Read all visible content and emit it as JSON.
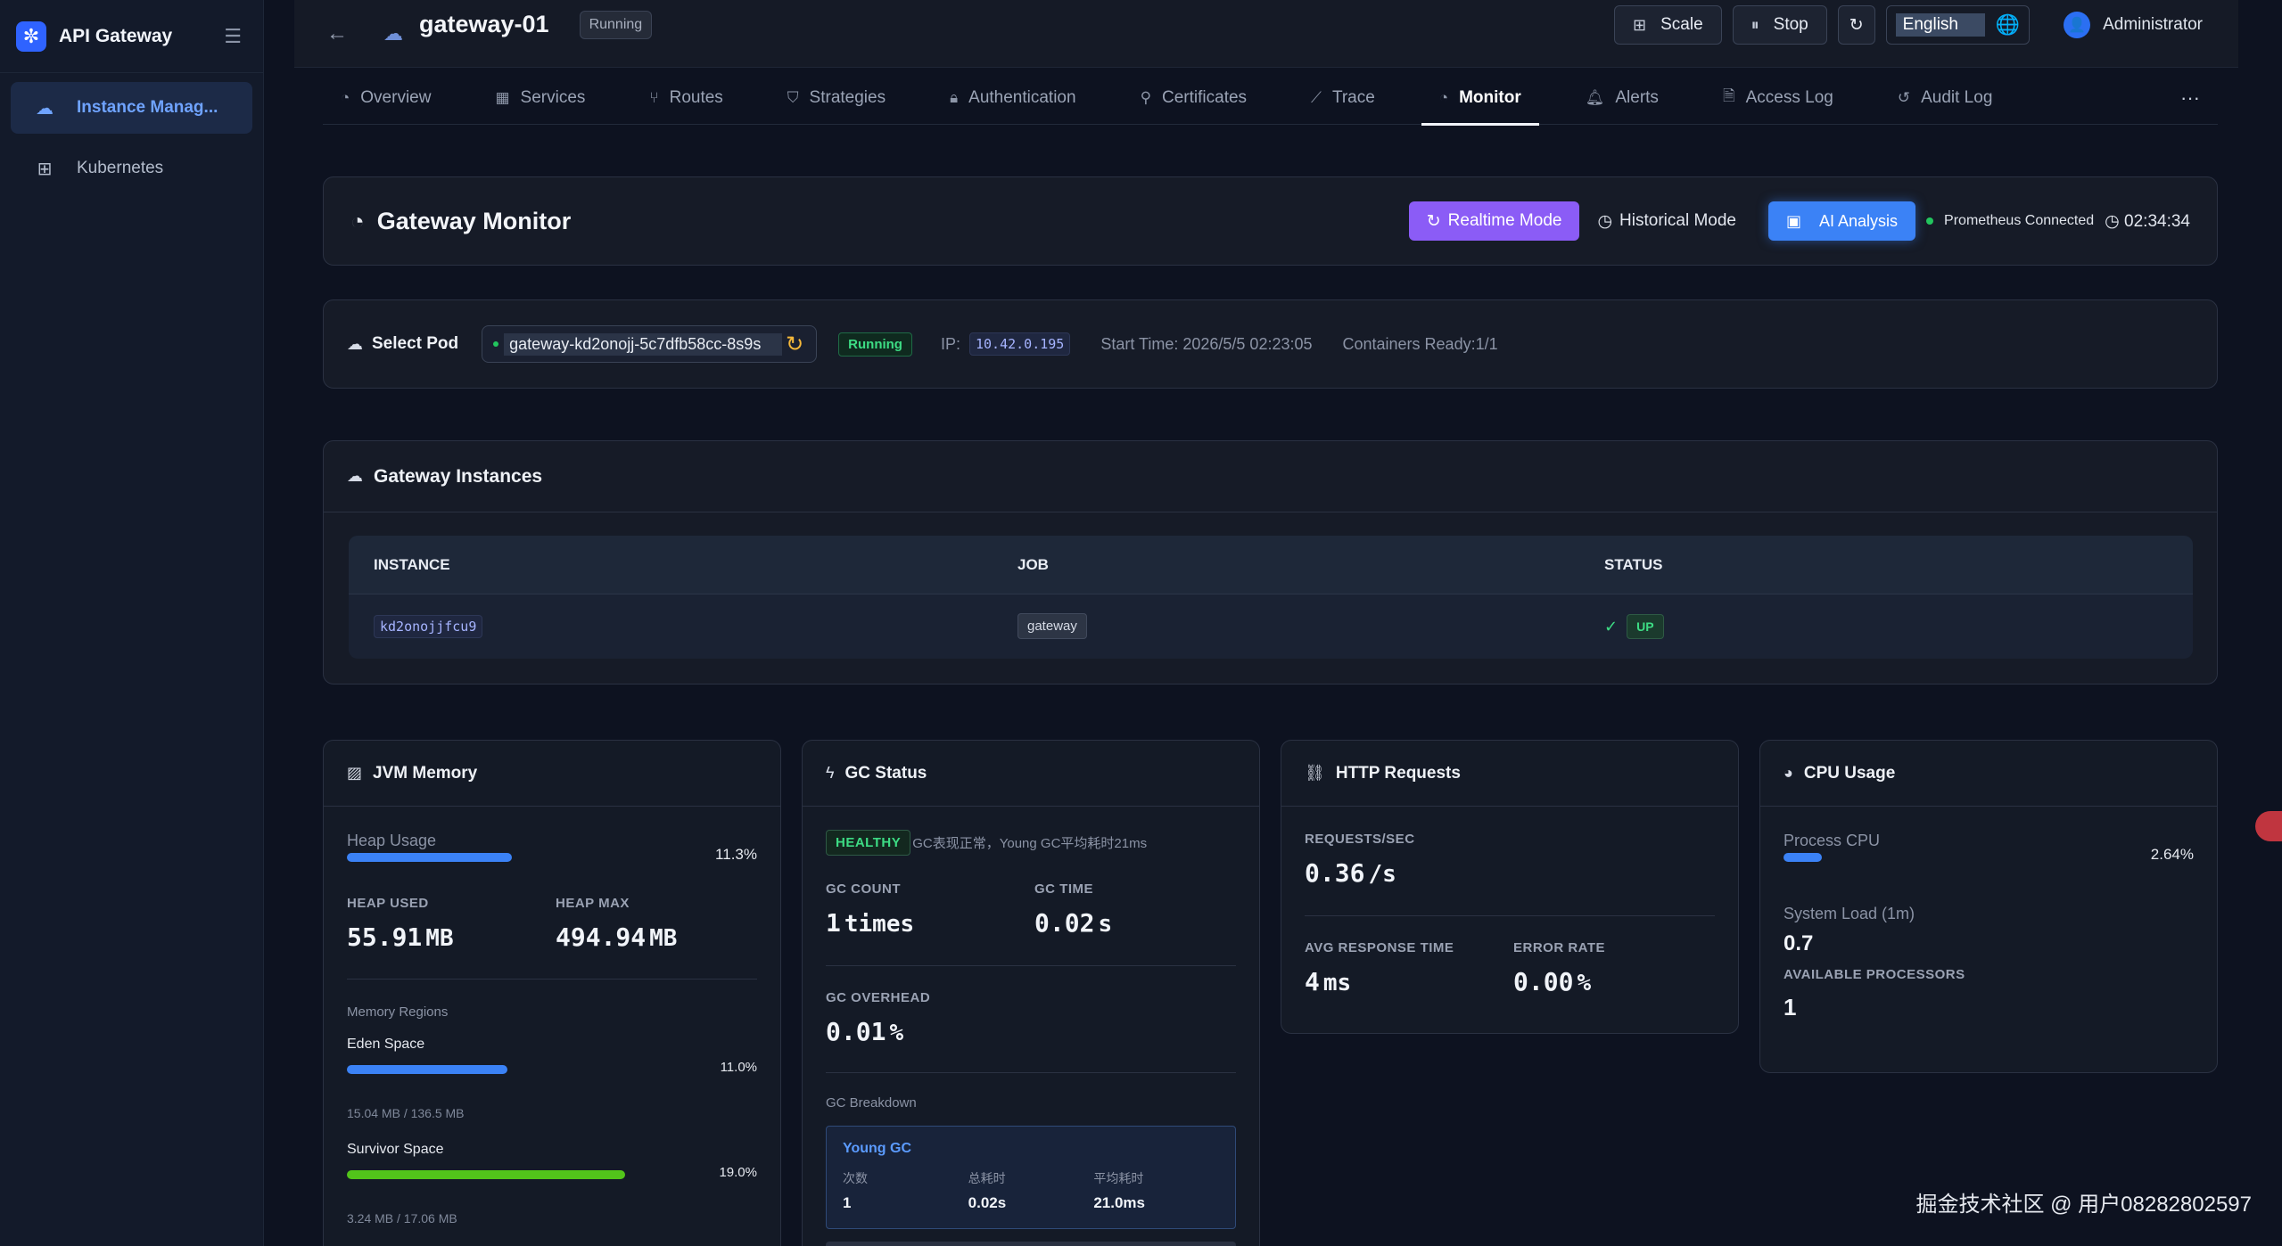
{
  "app": {
    "title": "API Gateway"
  },
  "sidebar": {
    "items": [
      {
        "label": "Instance Manag...",
        "icon": "cloud-icon",
        "active": true
      },
      {
        "label": "Kubernetes",
        "icon": "cluster-icon",
        "active": false
      }
    ]
  },
  "header": {
    "gateway_name": "gateway-01",
    "status": "Running",
    "scale_label": "Scale",
    "stop_label": "Stop",
    "language": "English",
    "user": "Administrator"
  },
  "tabs": [
    {
      "label": "Overview",
      "icon": "gauge-icon"
    },
    {
      "label": "Services",
      "icon": "grid-icon"
    },
    {
      "label": "Routes",
      "icon": "route-icon"
    },
    {
      "label": "Strategies",
      "icon": "shield-icon"
    },
    {
      "label": "Authentication",
      "icon": "lock-icon"
    },
    {
      "label": "Certificates",
      "icon": "key-icon"
    },
    {
      "label": "Trace",
      "icon": "chart-line-icon"
    },
    {
      "label": "Monitor",
      "icon": "gauge-icon",
      "active": true
    },
    {
      "label": "Alerts",
      "icon": "bell-icon"
    },
    {
      "label": "Access Log",
      "icon": "file-icon"
    },
    {
      "label": "Audit Log",
      "icon": "history-icon"
    }
  ],
  "monitor": {
    "title": "Gateway Monitor",
    "realtime_label": "Realtime Mode",
    "historical_label": "Historical Mode",
    "ai_label": "AI Analysis",
    "prometheus": "Prometheus Connected",
    "time": "02:34:34"
  },
  "pod": {
    "label": "Select Pod",
    "selected": "gateway-kd2onojj-5c7dfb58cc-8s9s",
    "status": "Running",
    "ip_label": "IP:",
    "ip": "10.42.0.195",
    "start_time": "Start Time: 2026/5/5 02:23:05",
    "containers": "Containers Ready:1/1"
  },
  "instances": {
    "title": "Gateway Instances",
    "columns": [
      "INSTANCE",
      "JOB",
      "STATUS"
    ],
    "rows": [
      {
        "instance": "kd2onojjfcu9",
        "job": "gateway",
        "status": "UP"
      }
    ]
  },
  "jvm": {
    "title": "JVM Memory",
    "heap_usage_label": "Heap Usage",
    "heap_usage_pct": "11.3%",
    "heap_usage_value": 0.113,
    "heap_used_label": "HEAP USED",
    "heap_used": "55.91",
    "heap_max_label": "HEAP MAX",
    "heap_max": "494.94",
    "unit": "MB",
    "regions_label": "Memory Regions",
    "regions": [
      {
        "name": "Eden Space",
        "pct": "11.0%",
        "value": 0.11,
        "detail": "15.04 MB / 136.5 MB",
        "color": "#3b82f6"
      },
      {
        "name": "Survivor Space",
        "pct": "19.0%",
        "value": 0.19,
        "detail": "3.24 MB / 17.06 MB",
        "color": "#52c41a"
      }
    ]
  },
  "gc": {
    "title": "GC Status",
    "health": "HEALTHY",
    "message": "GC表现正常，Young GC平均耗时21ms",
    "count_label": "GC COUNT",
    "count": "1",
    "count_unit": "times",
    "time_label": "GC TIME",
    "time": "0.02",
    "time_unit": "s",
    "overhead_label": "GC OVERHEAD",
    "overhead": "0.01",
    "overhead_unit": "%",
    "breakdown_label": "GC Breakdown",
    "young": {
      "title": "Young GC",
      "count_label": "次数",
      "count": "1",
      "total_label": "总耗时",
      "total": "0.02s",
      "avg_label": "平均耗时",
      "avg": "21.0ms"
    }
  },
  "http": {
    "title": "HTTP Requests",
    "rps_label": "REQUESTS/SEC",
    "rps": "0.36",
    "rps_unit": "/s",
    "avg_label": "AVG RESPONSE TIME",
    "avg": "4",
    "avg_unit": "ms",
    "err_label": "ERROR RATE",
    "err": "0.00",
    "err_unit": "%"
  },
  "cpu": {
    "title": "CPU Usage",
    "process_label": "Process CPU",
    "process_pct": "2.64%",
    "process_value": 0.0264,
    "load_label": "System Load (1m)",
    "load": "0.7",
    "proc_label": "AVAILABLE PROCESSORS",
    "proc": "1"
  },
  "watermark": "掘金技术社区 @ 用户08282802597",
  "colors": {
    "accent": "#3b82f6",
    "purple": "#8b5cf6",
    "green": "#3ddc84"
  }
}
